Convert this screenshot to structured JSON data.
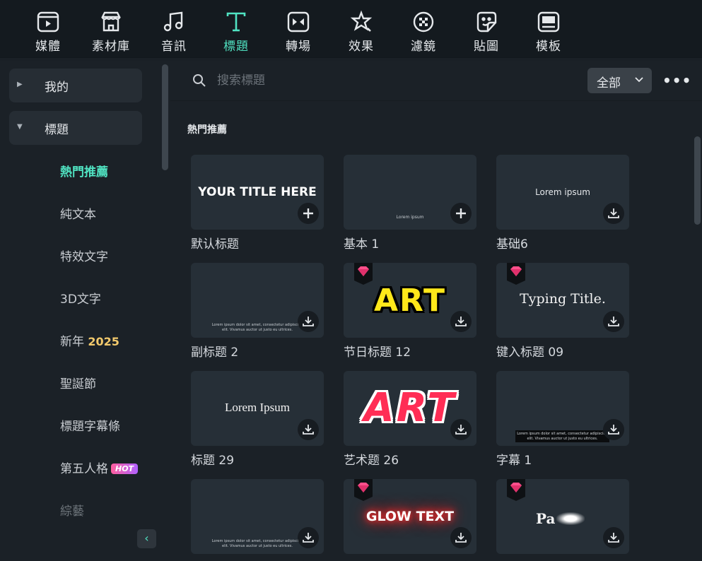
{
  "colors": {
    "accent": "#50e3c2",
    "background": "#141a1f",
    "panel": "#1b2127",
    "card": "#262f37"
  },
  "top_nav": [
    {
      "label": "媒體",
      "icon": "media-icon"
    },
    {
      "label": "素材庫",
      "icon": "store-icon"
    },
    {
      "label": "音訊",
      "icon": "music-icon"
    },
    {
      "label": "標題",
      "icon": "title-t-icon",
      "active": true
    },
    {
      "label": "轉場",
      "icon": "transition-icon"
    },
    {
      "label": "效果",
      "icon": "effects-icon"
    },
    {
      "label": "濾鏡",
      "icon": "filter-icon"
    },
    {
      "label": "貼圖",
      "icon": "sticker-icon"
    },
    {
      "label": "模板",
      "icon": "template-icon"
    }
  ],
  "sidebar": {
    "groups": [
      {
        "label": "我的",
        "expanded": false
      },
      {
        "label": "標題",
        "expanded": true
      }
    ],
    "items": [
      {
        "label": "熱門推薦",
        "active": true
      },
      {
        "label": "純文本"
      },
      {
        "label": "特效文字"
      },
      {
        "label": "3D文字"
      },
      {
        "label": "新年",
        "extra": "2025"
      },
      {
        "label": "聖誕節"
      },
      {
        "label": "標題字幕條"
      },
      {
        "label": "第五人格",
        "badge": "HOT"
      },
      {
        "label": "綜藝"
      }
    ]
  },
  "search": {
    "placeholder": "搜索標題",
    "value": ""
  },
  "filter": {
    "selected": "全部"
  },
  "section_title": "熱門推薦",
  "cards": [
    {
      "label": "默认标题",
      "preview": "YOUR TITLE HERE",
      "action": "add",
      "premium": false
    },
    {
      "label": "基本 1",
      "preview": "Lorem ipsum",
      "action": "add",
      "premium": false
    },
    {
      "label": "基础6",
      "preview": "Lorem ipsum",
      "action": "download",
      "premium": false
    },
    {
      "label": "副标题 2",
      "preview": "Lorem ipsum dolor sit amet, consectetur adipiscing elit. Vivamus auctor ut justo eu ultrices.",
      "action": "download",
      "premium": false
    },
    {
      "label": "节日标题 12",
      "preview": "ART",
      "action": "download",
      "premium": true
    },
    {
      "label": "键入标题 09",
      "preview": "Typing Title.",
      "action": "download",
      "premium": true
    },
    {
      "label": "标题 29",
      "preview": "Lorem Ipsum",
      "action": "download",
      "premium": false
    },
    {
      "label": "艺术题 26",
      "preview": "ART",
      "action": "download",
      "premium": false
    },
    {
      "label": "字幕 1",
      "preview": "Lorem ipsum dolor sit amet, consectetur adipiscing elit. Vivamus auctor ut justo eu ultrices.",
      "action": "download",
      "premium": false
    },
    {
      "label": "",
      "preview": "Lorem ipsum dolor sit amet, consectetur adipiscing elit. Vivamus auctor ut justo eu ultrices.",
      "action": "download",
      "premium": false
    },
    {
      "label": "",
      "preview": "GLOW TEXT",
      "action": "download",
      "premium": true
    },
    {
      "label": "",
      "preview": "Pa",
      "action": "download",
      "premium": true
    }
  ]
}
